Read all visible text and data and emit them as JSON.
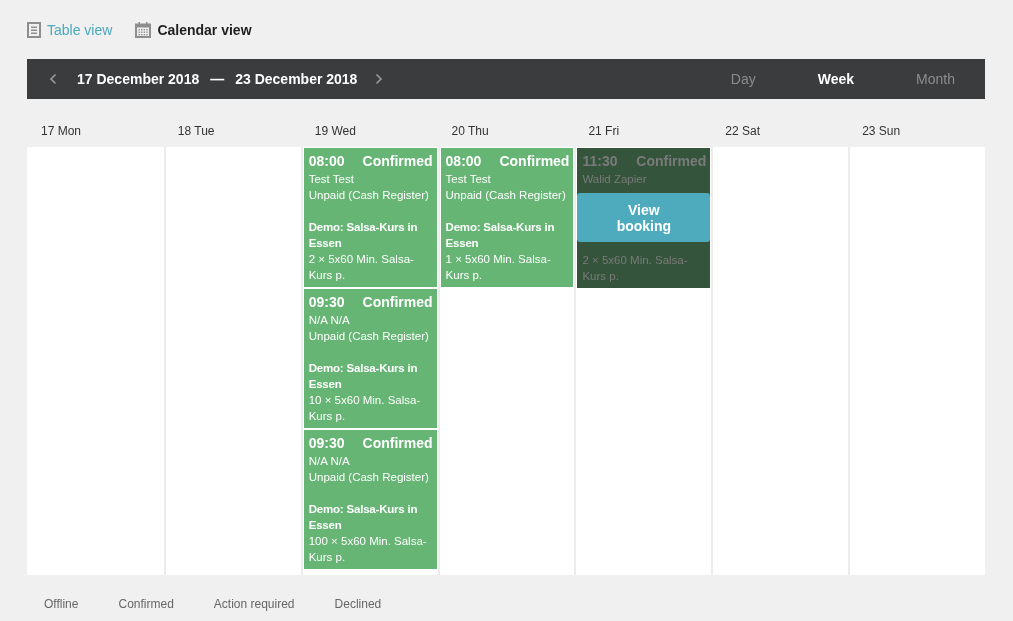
{
  "view_switcher": [
    {
      "kind": "table",
      "label": "Table view",
      "selected": false
    },
    {
      "kind": "calendar",
      "label": "Calendar view",
      "selected": true
    }
  ],
  "toolbar": {
    "range_start": "17 December 2018",
    "separator": "—",
    "range_end": "23 December 2018",
    "modes": [
      {
        "label": "Day",
        "selected": false
      },
      {
        "label": "Week",
        "selected": true
      },
      {
        "label": "Month",
        "selected": false
      }
    ]
  },
  "days": [
    {
      "label": "17 Mon"
    },
    {
      "label": "18 Tue"
    },
    {
      "label": "19 Wed",
      "bookings": [
        {
          "time": "08:00",
          "status": "Confirmed",
          "customer": "Test Test",
          "payment": "Unpaid (Cash Register)",
          "course": "Demo: Salsa-Kurs in Essen",
          "item": "2 × 5x60 Min. Salsa-Kurs p.",
          "hovered": false
        },
        {
          "time": "09:30",
          "status": "Confirmed",
          "customer": "N/A N/A",
          "payment": "Unpaid (Cash Register)",
          "course": "Demo: Salsa-Kurs in Essen",
          "item": "10 × 5x60 Min. Salsa-Kurs p.",
          "hovered": false
        },
        {
          "time": "09:30",
          "status": "Confirmed",
          "customer": "N/A N/A",
          "payment": "Unpaid (Cash Register)",
          "course": "Demo: Salsa-Kurs in Essen",
          "item": "100 × 5x60 Min. Salsa-Kurs p.",
          "hovered": false
        }
      ]
    },
    {
      "label": "20 Thu",
      "bookings": [
        {
          "time": "08:00",
          "status": "Confirmed",
          "customer": "Test Test",
          "payment": "Unpaid (Cash Register)",
          "course": "Demo: Salsa-Kurs in Essen",
          "item": "1 × 5x60 Min. Salsa-Kurs p.",
          "hovered": false
        }
      ]
    },
    {
      "label": "21 Fri",
      "bookings": [
        {
          "time": "11:30",
          "status": "Confirmed",
          "customer": "Walid Zapier",
          "item": "2 × 5x60 Min. Salsa-Kurs p.",
          "hovered": true,
          "action": "View booking"
        }
      ]
    },
    {
      "label": "22 Sat"
    },
    {
      "label": "23 Sun"
    }
  ],
  "legend": [
    "Offline",
    "Confirmed",
    "Action required",
    "Declined"
  ]
}
